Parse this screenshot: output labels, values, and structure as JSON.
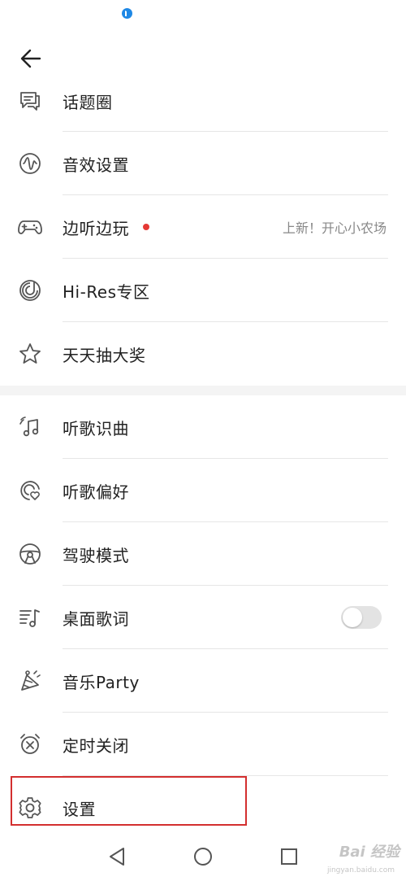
{
  "status": {
    "indicator_color": "#1e88e5"
  },
  "header": {
    "back_icon": "arrow-left-icon"
  },
  "menu": {
    "items": [
      {
        "label": "话题圈",
        "icon": "chat-bubbles-icon"
      },
      {
        "label": "音效设置",
        "icon": "sound-wave-icon"
      },
      {
        "label": "边听边玩",
        "icon": "gamepad-icon",
        "has_badge": true,
        "hint": "上新！开心小农场"
      },
      {
        "label": "Hi-Res专区",
        "icon": "hi-res-icon"
      },
      {
        "label": "天天抽大奖",
        "icon": "star-icon"
      },
      {
        "label": "听歌识曲",
        "icon": "music-recognize-icon"
      },
      {
        "label": "听歌偏好",
        "icon": "preference-heart-icon"
      },
      {
        "label": "驾驶模式",
        "icon": "steering-wheel-icon"
      },
      {
        "label": "桌面歌词",
        "icon": "lyrics-icon",
        "toggle_on": false
      },
      {
        "label": "音乐Party",
        "icon": "party-hat-icon"
      },
      {
        "label": "定时关闭",
        "icon": "alarm-clock-icon"
      },
      {
        "label": "设置",
        "icon": "gear-icon"
      }
    ]
  },
  "navbar": {
    "back": "nav-back-icon",
    "home": "nav-home-icon",
    "recents": "nav-recents-icon"
  },
  "watermark": {
    "text": "Bai 经验",
    "sub": "jingyan.baidu.com"
  },
  "colors": {
    "badge": "#e53935",
    "highlight": "#d32f2f",
    "divider": "#e6e6e6"
  }
}
